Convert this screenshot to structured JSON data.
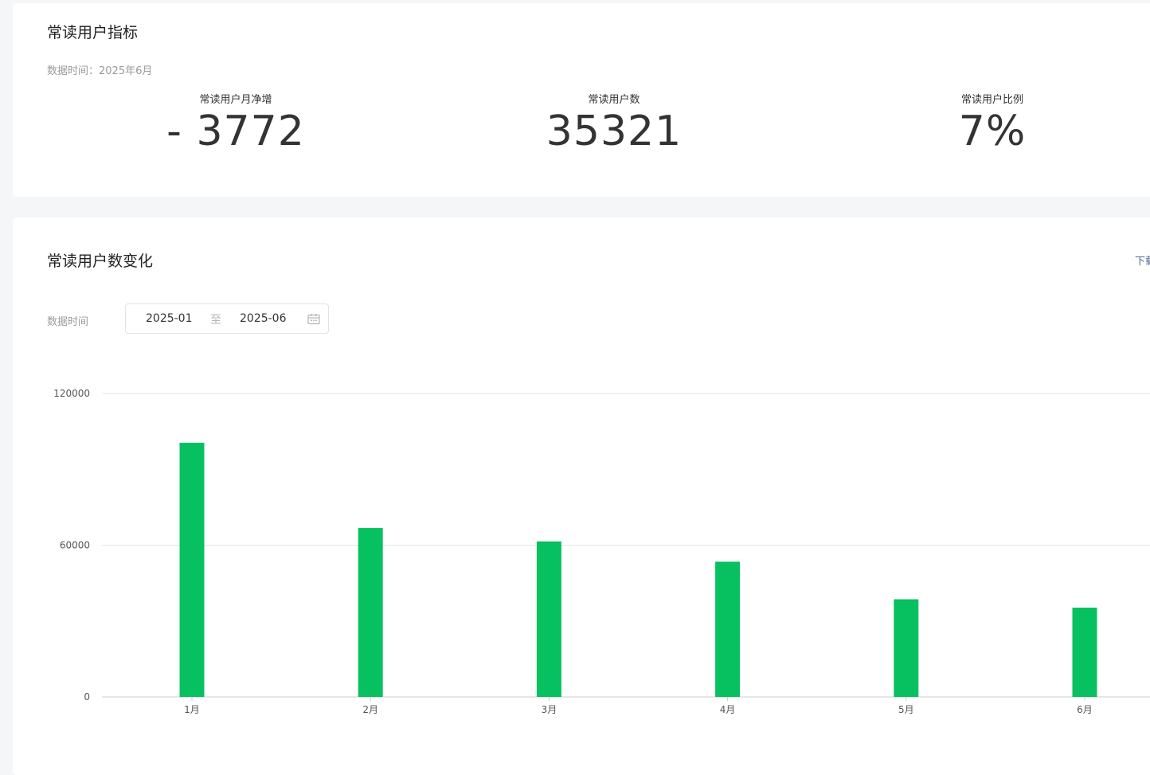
{
  "metrics": {
    "title": "常读用户指标",
    "data_time": "数据时间：2025年6月",
    "items": [
      {
        "label": "常读用户月净增",
        "value": "- 3772"
      },
      {
        "label": "常读用户数",
        "value": "35321"
      },
      {
        "label": "常读用户比例",
        "value": "7%"
      }
    ]
  },
  "trend": {
    "title": "常读用户数变化",
    "download_label": "下载",
    "data_time_label": "数据时间",
    "range": {
      "start": "2025-01",
      "separator": "至",
      "end": "2025-06"
    },
    "calendar_icon": "calendar-icon"
  },
  "colors": {
    "bar": "#07c160",
    "grid": "#e6e6e6",
    "axis": "#cccccc"
  },
  "chart_data": {
    "type": "bar",
    "categories": [
      "1月",
      "2月",
      "3月",
      "4月",
      "5月",
      "6月"
    ],
    "series": [
      {
        "values": [
          100500,
          66800,
          61500,
          53500,
          38600,
          35321
        ]
      }
    ],
    "ylim": [
      0,
      120000
    ],
    "yticks": [
      0,
      60000,
      120000
    ],
    "grid": true,
    "legend": "none"
  }
}
